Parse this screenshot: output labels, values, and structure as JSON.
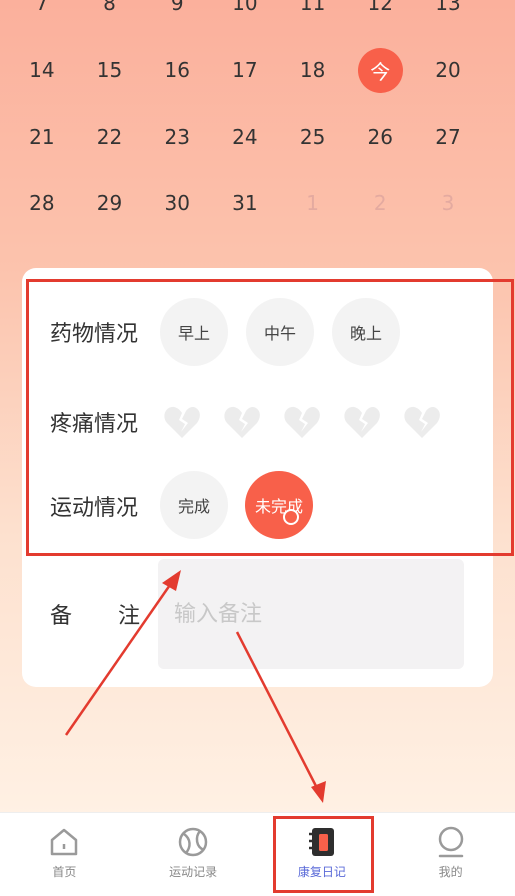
{
  "calendar": {
    "weeks": [
      [
        {
          "d": "7"
        },
        {
          "d": "8"
        },
        {
          "d": "9"
        },
        {
          "d": "10"
        },
        {
          "d": "11"
        },
        {
          "d": "12"
        },
        {
          "d": "13"
        }
      ],
      [
        {
          "d": "14"
        },
        {
          "d": "15"
        },
        {
          "d": "16"
        },
        {
          "d": "17"
        },
        {
          "d": "18"
        },
        {
          "d": "今",
          "today": true
        },
        {
          "d": "20"
        }
      ],
      [
        {
          "d": "21"
        },
        {
          "d": "22"
        },
        {
          "d": "23"
        },
        {
          "d": "24"
        },
        {
          "d": "25"
        },
        {
          "d": "26"
        },
        {
          "d": "27"
        }
      ],
      [
        {
          "d": "28"
        },
        {
          "d": "29"
        },
        {
          "d": "30"
        },
        {
          "d": "31"
        },
        {
          "d": "1",
          "other": true
        },
        {
          "d": "2",
          "other": true
        },
        {
          "d": "3",
          "other": true
        }
      ]
    ]
  },
  "form": {
    "medication": {
      "label": "药物情况",
      "options": [
        "早上",
        "中午",
        "晚上"
      ]
    },
    "pain": {
      "label": "疼痛情况",
      "level_count": 5
    },
    "exercise": {
      "label": "运动情况",
      "options": [
        "完成",
        "未完成"
      ],
      "selected": "未完成"
    },
    "note": {
      "label_a": "备",
      "label_b": "注",
      "placeholder": "输入备注",
      "value": ""
    }
  },
  "tabbar": [
    {
      "label": "首页",
      "icon": "home-icon"
    },
    {
      "label": "运动记录",
      "icon": "ball-icon"
    },
    {
      "label": "康复日记",
      "icon": "notebook-icon",
      "active": true
    },
    {
      "label": "我的",
      "icon": "profile-icon"
    }
  ],
  "colors": {
    "accent": "#f8604a",
    "annotation": "#e33b2f",
    "active_tab": "#5a6ad8"
  }
}
